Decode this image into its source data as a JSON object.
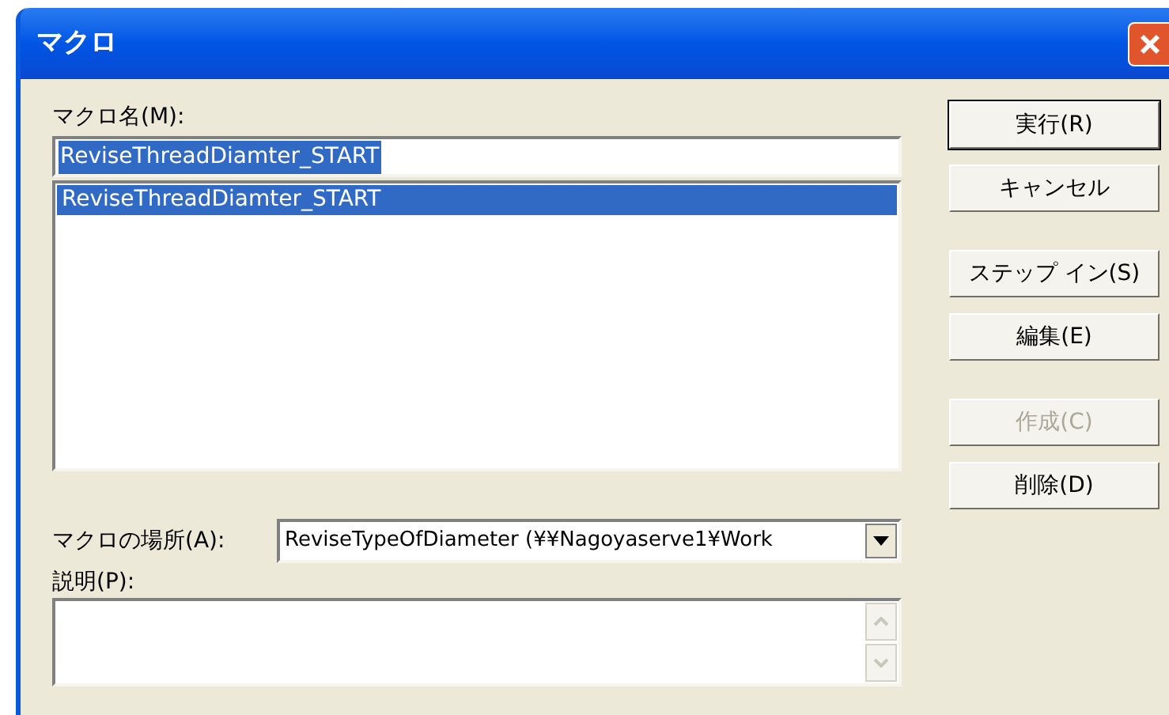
{
  "window": {
    "title": "マクロ"
  },
  "macro_name": {
    "label": "マクロ名(M):",
    "value": "ReviseThreadDiamter_START",
    "value_selected": true
  },
  "macro_list": [
    {
      "text": "ReviseThreadDiamter_START",
      "selected": true
    }
  ],
  "button_groups": [
    [
      {
        "label": "実行(R)",
        "disabled": false,
        "default": true
      },
      {
        "label": "キャンセル",
        "disabled": false,
        "default": false
      }
    ],
    [
      {
        "label": "ステップ イン(S)",
        "disabled": false,
        "default": false
      },
      {
        "label": "編集(E)",
        "disabled": false,
        "default": false
      }
    ],
    [
      {
        "label": "作成(C)",
        "disabled": true,
        "default": false
      },
      {
        "label": "削除(D)",
        "disabled": false,
        "default": false
      }
    ]
  ],
  "location": {
    "label": "マクロの場所(A):",
    "value": "ReviseTypeOfDiameter (¥¥Nagoyaserve1¥Work"
  },
  "description": {
    "label": "説明(P):"
  }
}
